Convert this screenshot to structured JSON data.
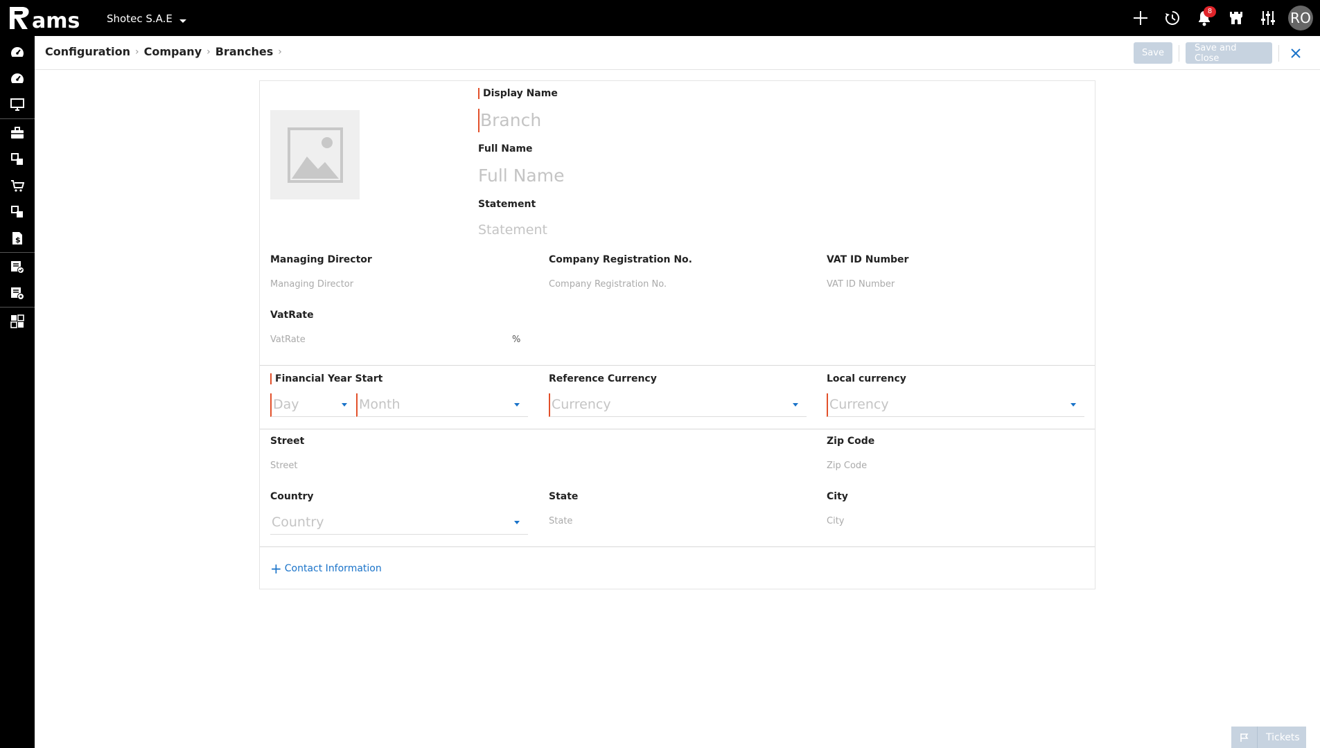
{
  "app": {
    "logo_text": "Rams",
    "company": "Shotec S.A.E"
  },
  "topbar": {
    "icons": [
      "plus-icon",
      "history-icon",
      "bell-icon",
      "castle-icon",
      "sliders-icon"
    ],
    "notifications_count": "8",
    "avatar_initials": "RO"
  },
  "sidebar": {
    "icons": [
      "dashboard-icon",
      "dashboard-alt-icon",
      "monitor-icon",
      "briefcase-icon",
      "modules-icon",
      "cart-icon",
      "modules-alt-icon",
      "invoice-dollar-icon",
      "document-check-icon",
      "document-settings-icon",
      "grid-settings-icon"
    ]
  },
  "breadcrumb": [
    "Configuration",
    "Company",
    "Branches"
  ],
  "header": {
    "save_label": "Save",
    "save_close_label": "Save and Close"
  },
  "form": {
    "display_name": {
      "label": "Display Name",
      "placeholder": "Branch"
    },
    "full_name": {
      "label": "Full Name",
      "placeholder": "Full Name"
    },
    "statement": {
      "label": "Statement",
      "placeholder": "Statement"
    },
    "managing_director": {
      "label": "Managing Director",
      "placeholder": "Managing Director"
    },
    "company_registration": {
      "label": "Company Registration No.",
      "placeholder": "Company Registration No."
    },
    "vat_id": {
      "label": "VAT ID Number",
      "placeholder": "VAT ID Number"
    },
    "vat_rate": {
      "label": "VatRate",
      "placeholder": "VatRate",
      "suffix": "%"
    },
    "financial_year_start": {
      "label": "Financial Year Start",
      "day_placeholder": "Day",
      "month_placeholder": "Month"
    },
    "reference_currency": {
      "label": "Reference Currency",
      "placeholder": "Currency"
    },
    "local_currency": {
      "label": "Local currency",
      "placeholder": "Currency"
    },
    "street": {
      "label": "Street",
      "placeholder": "Street"
    },
    "zip_code": {
      "label": "Zip Code",
      "placeholder": "Zip Code"
    },
    "country": {
      "label": "Country",
      "placeholder": "Country"
    },
    "state": {
      "label": "State",
      "placeholder": "State"
    },
    "city": {
      "label": "City",
      "placeholder": "City"
    },
    "contact_link": "Contact Information"
  },
  "tickets_label": "Tickets",
  "colors": {
    "accent": "#1a73c9",
    "required": "#e2502a",
    "disabled_button": "#c7d3e0",
    "bar": "#000000",
    "badge": "#e0242a"
  }
}
